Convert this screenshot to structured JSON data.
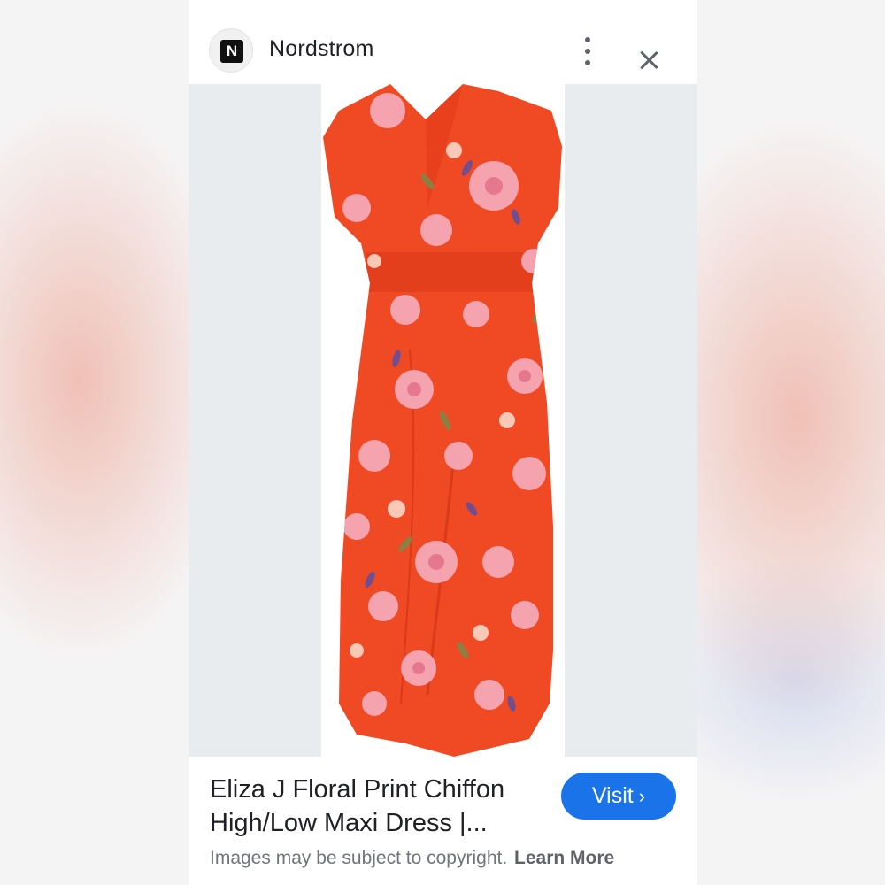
{
  "site": {
    "name": "Nordstrom",
    "logo_letter": "N"
  },
  "result": {
    "title_line1": "Eliza J Floral Print Chiffon",
    "title_line2": "High/Low Maxi Dress |...",
    "visit_label": "Visit",
    "visit_icon": "chevron-right-icon",
    "copyright_text": "Images may be subject to copyright.",
    "learn_more_label": "Learn More"
  },
  "colors": {
    "accent": "#1a73e8",
    "dress": "#ef4a24",
    "flower_pink": "#f5a8b8"
  },
  "icons": [
    "more-vert-icon",
    "close-icon",
    "chevron-right-icon"
  ]
}
